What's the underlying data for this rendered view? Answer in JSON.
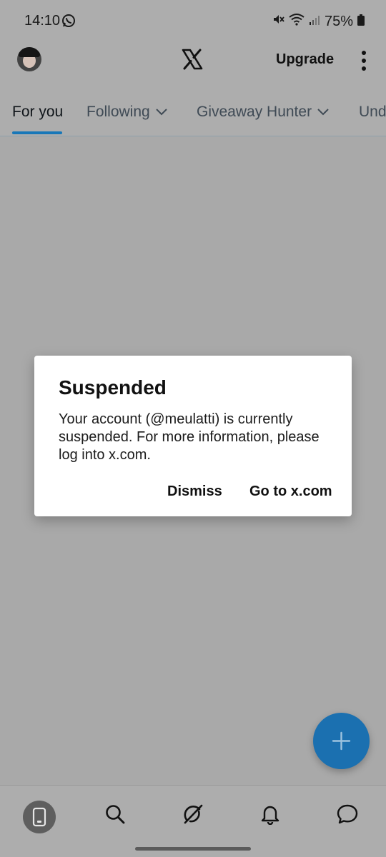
{
  "status_bar": {
    "time": "14:10",
    "battery": "75%",
    "icons": [
      "whatsapp-icon",
      "mute-icon",
      "wifi-icon",
      "signal-icon",
      "battery-icon"
    ]
  },
  "header": {
    "upgrade_label": "Upgrade",
    "icons": [
      "avatar",
      "x-logo-icon",
      "more-vertical-icon"
    ]
  },
  "tabs": [
    {
      "label": "For you",
      "active": true
    },
    {
      "label": "Following",
      "dropdown": true
    },
    {
      "label": "Giveaway Hunter",
      "dropdown": true
    },
    {
      "label": "Und"
    }
  ],
  "dialog": {
    "title": "Suspended",
    "body": "Your account (@meulatti) is currently suspended. For more information, please log into x.com.",
    "dismiss_label": "Dismiss",
    "goto_label": "Go to x.com"
  },
  "fab": {
    "icon": "plus-icon"
  },
  "bottom_nav": {
    "items": [
      "home-icon",
      "search-icon",
      "grok-icon",
      "notifications-icon",
      "messages-icon"
    ]
  },
  "colors": {
    "accent": "#1b70b0",
    "overlay_bg": "#a9a9a9"
  }
}
